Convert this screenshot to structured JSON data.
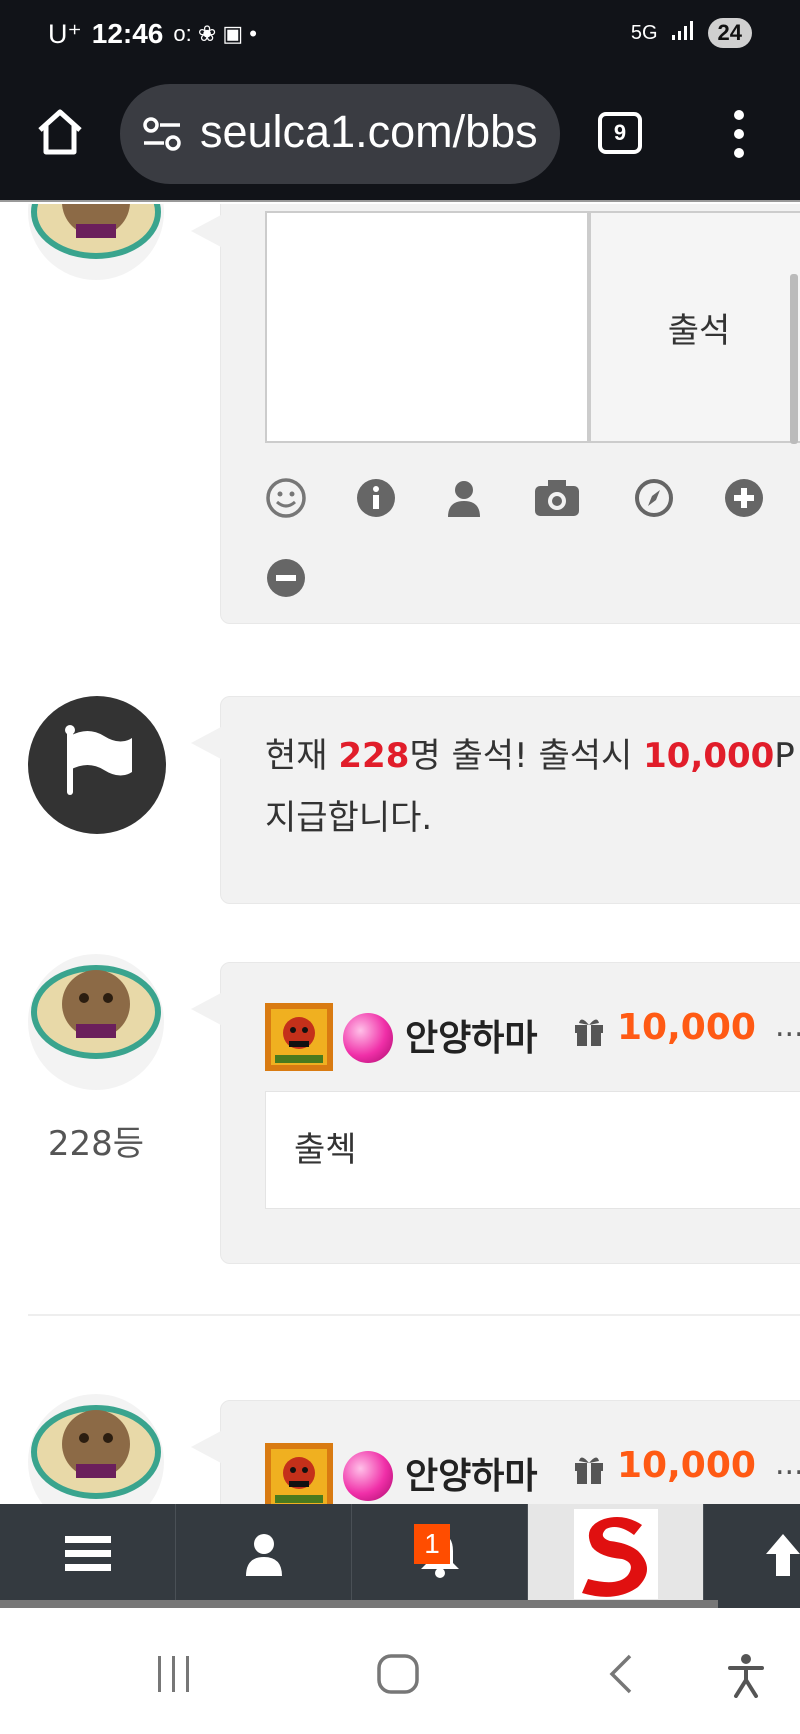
{
  "status_bar": {
    "carrier": "U⁺",
    "time": "12:46",
    "network": "5G",
    "battery": "24"
  },
  "browser": {
    "url": "seulca1.com/bbs",
    "tab_count": "9"
  },
  "checkin_form": {
    "submit_label": "출석",
    "toolbar_icons": [
      "smile-icon",
      "info-icon",
      "user-icon",
      "camera-icon",
      "compass-icon",
      "plus-circle-icon",
      "minus-circle-icon"
    ]
  },
  "notice": {
    "prefix": "현재 ",
    "count": "228",
    "middle": "명 출석! 출석시 ",
    "points": "10,000",
    "suffix": "P",
    "line2": "지급합니다."
  },
  "comments": [
    {
      "rank": "228등",
      "nickname": "안양하마",
      "points": "10,000",
      "more": "...",
      "text": "출첵"
    },
    {
      "nickname": "안양하마",
      "points": "10,000",
      "more": "..."
    }
  ],
  "bottom_nav": {
    "notification_badge": "1"
  },
  "colors": {
    "accent_red": "#e11d2a",
    "points_orange": "#ff5a14",
    "nav_bg": "#343a40"
  }
}
